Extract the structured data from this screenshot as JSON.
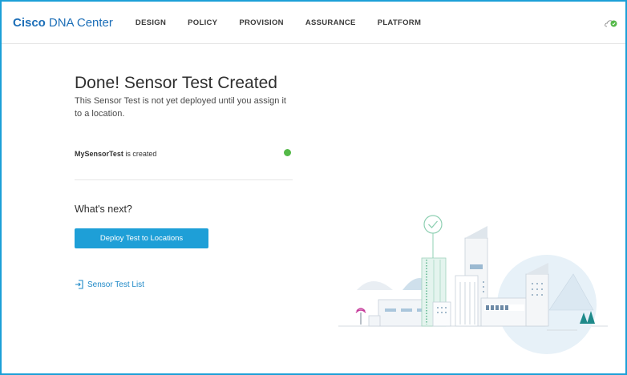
{
  "header": {
    "brand_bold": "Cisco",
    "brand_rest": "DNA Center",
    "nav": [
      "DESIGN",
      "POLICY",
      "PROVISION",
      "ASSURANCE",
      "PLATFORM"
    ],
    "status_icon": "cloud-check-icon"
  },
  "main": {
    "title": "Done! Sensor Test Created",
    "subtitle": "This Sensor Test is not yet deployed until you assign it to a location.",
    "created_name": "MySensorTest",
    "created_suffix": " is created",
    "next_heading": "What's next?",
    "deploy_button": "Deploy Test to Locations",
    "list_link": "Sensor Test List"
  },
  "colors": {
    "accent": "#1e9fd7",
    "success": "#54b948",
    "frame": "#1ba0d7"
  }
}
